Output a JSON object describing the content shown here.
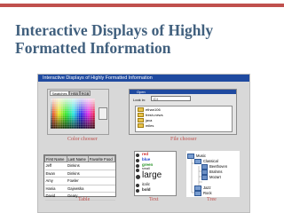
{
  "slide": {
    "title_line1": "Interactive Displays of Highly",
    "title_line2": "Formatted Information",
    "accent_color": "#c0504d",
    "title_color": "#41607e"
  },
  "panel": {
    "header": "Interactive Displays of Highly Formatted Information"
  },
  "color_chooser": {
    "tabs": [
      "Swatches",
      "HSB",
      "RGB"
    ],
    "active_tab": "Swatches",
    "caption": "Color chooser"
  },
  "file_chooser": {
    "window_title": "Open",
    "look_in_label": "Look in:",
    "look_in_value": "C:\\",
    "items": [
      "ethan106",
      "fresh-news",
      "java",
      "miles"
    ],
    "caption": "File chooser"
  },
  "table": {
    "columns": [
      "First Name",
      "Last Name",
      "Favorite Food"
    ],
    "rows": [
      [
        "Jeff",
        "Dinkins",
        ""
      ],
      [
        "Ewan",
        "Dinkins",
        ""
      ],
      [
        "Amy",
        "Fowler",
        ""
      ],
      [
        "Hania",
        "Gajewska",
        ""
      ],
      [
        "David",
        "Geary",
        ""
      ]
    ],
    "caption": "Table"
  },
  "text": {
    "items": [
      {
        "label": "red",
        "color": "#d02020"
      },
      {
        "label": "blue",
        "color": "#2040d0"
      },
      {
        "label": "green",
        "color": "#209020"
      },
      {
        "label": "small",
        "color": "#222222"
      },
      {
        "label": "large",
        "color": "#111111"
      },
      {
        "label": "italic",
        "color": "#222222"
      },
      {
        "label": "bold",
        "color": "#222222"
      }
    ],
    "caption": "Text"
  },
  "tree": {
    "root": "Music",
    "nodes": [
      "Classical",
      "Beethoven",
      "Brahms",
      "Mozart",
      "Jazz",
      "Rock"
    ],
    "caption": "Tree"
  }
}
